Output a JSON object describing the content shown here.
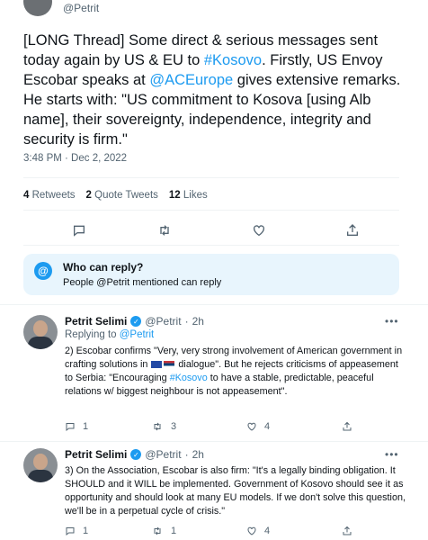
{
  "header": {
    "handle": "@Petrit"
  },
  "main_tweet": {
    "text_parts": [
      {
        "t": "[LONG Thread] Some direct & serious messages sent today again by US & EU to ",
        "hl": false
      },
      {
        "t": "#Kosovo",
        "hl": true
      },
      {
        "t": ". Firstly, US Envoy Escobar speaks at ",
        "hl": false
      },
      {
        "t": "@ACEurope",
        "hl": true
      },
      {
        "t": " gives extensive remarks. He starts with: \"US commitment to Kosova [using Alb name], their sovereignty, independence, integrity and security is firm.\"",
        "hl": false
      }
    ],
    "timestamp": "3:48 PM · Dec 2, 2022",
    "stats": {
      "retweets_count": "4",
      "retweets_label": "Retweets",
      "quotes_count": "2",
      "quotes_label": "Quote Tweets",
      "likes_count": "12",
      "likes_label": "Likes"
    }
  },
  "who_can_reply": {
    "title": "Who can reply?",
    "subtitle": "People @Petrit mentioned can reply"
  },
  "replies": [
    {
      "name": "Petrit Selimi",
      "handle": "@Petrit",
      "time": "2h",
      "replying_label": "Replying to ",
      "replying_to": "@Petrit",
      "text_a": "2) Escobar confirms \"Very, very strong involvement of American government in crafting solutions in ",
      "text_b": " dialogue\". But he rejects criticisms of appeasement to Serbia: \"Encouraging ",
      "hashtag": "#Kosovo",
      "text_c": " to have a stable, predictable, peaceful relations w/ biggest neighbour is not appeasement\".",
      "reply_count": "1",
      "retweet_count": "3",
      "like_count": "4"
    },
    {
      "name": "Petrit Selimi",
      "handle": "@Petrit",
      "time": "2h",
      "text": "3) On the Association, Escobar is also firm: \"It's a legally binding obligation. It SHOULD and it WILL be implemented. Government of Kosovo should see it as opportunity and should look at many EU models. If we don't solve this question, we'll be in a perpetual cycle of crisis.\"",
      "reply_count": "1",
      "retweet_count": "1",
      "like_count": "4"
    }
  ],
  "icons": {
    "reply": "reply-icon",
    "retweet": "retweet-icon",
    "like": "heart-icon",
    "share": "share-icon",
    "more": "more-icon",
    "verified": "verified-badge-icon",
    "at": "at-sign-icon"
  },
  "colors": {
    "accent": "#1d9bf0",
    "text": "#0f1419",
    "muted": "#536471",
    "info_bg": "#e8f5fd"
  }
}
